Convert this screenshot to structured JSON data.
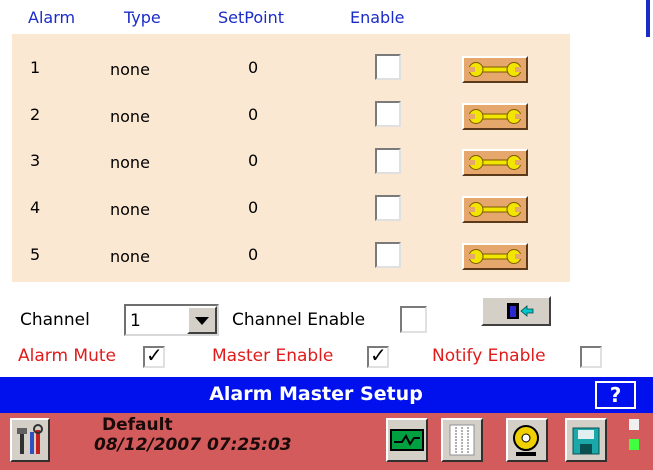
{
  "headers": [
    "Alarm",
    "Type",
    "SetPoint",
    "Enable"
  ],
  "rows": [
    {
      "alarm": "1",
      "type": "none",
      "setpoint": "0"
    },
    {
      "alarm": "2",
      "type": "none",
      "setpoint": "0"
    },
    {
      "alarm": "3",
      "type": "none",
      "setpoint": "0"
    },
    {
      "alarm": "4",
      "type": "none",
      "setpoint": "0"
    },
    {
      "alarm": "5",
      "type": "none",
      "setpoint": "0"
    }
  ],
  "channel": {
    "label": "Channel",
    "value": "1",
    "enable_label": "Channel Enable"
  },
  "options": {
    "alarm_mute": "Alarm Mute",
    "master_enable": "Master Enable",
    "notify_enable": "Notify Enable",
    "check": "✓"
  },
  "title": "Alarm Master Setup",
  "help": "?",
  "status": {
    "profile": "Default",
    "datetime": "08/12/2007 07:25:03"
  },
  "colors": {
    "title_bar": "#0011ee",
    "status_bar": "#d45b5b",
    "table_bg": "#fbe8d3",
    "header_text": "#1b2bc8",
    "option_text": "#e01b1b"
  },
  "icons": [
    "tools-icon",
    "wrench-icon",
    "exit-door-icon",
    "dropdown-arrow-icon",
    "help-icon",
    "trend-chart-icon",
    "columns-icon",
    "alarm-bell-icon",
    "save-disk-icon",
    "indicator-icon"
  ]
}
